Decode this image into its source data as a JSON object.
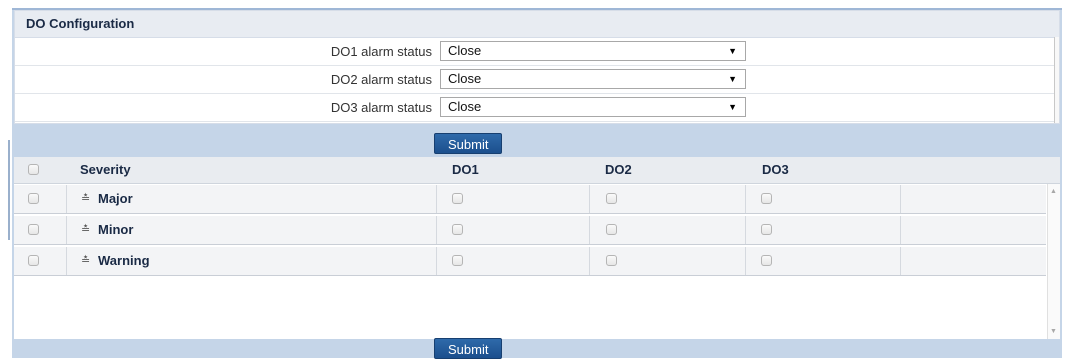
{
  "config": {
    "title": "DO Configuration",
    "rows": [
      {
        "label": "DO1 alarm status",
        "value": "Close"
      },
      {
        "label": "DO2 alarm status",
        "value": "Close"
      },
      {
        "label": "DO3 alarm status",
        "value": "Close"
      }
    ],
    "submit_label": "Submit"
  },
  "table": {
    "headers": {
      "severity": "Severity",
      "do1": "DO1",
      "do2": "DO2",
      "do3": "DO3"
    },
    "rows": [
      {
        "label": "Major"
      },
      {
        "label": "Minor"
      },
      {
        "label": "Warning"
      }
    ],
    "submit_label": "Submit"
  },
  "icons": {
    "expand": "double-chevron-down-icon",
    "dropdown": "triangle-down-icon"
  },
  "colors": {
    "button": "#1f548f",
    "frame": "#c5d5e8",
    "header_text": "#1a2a45"
  }
}
